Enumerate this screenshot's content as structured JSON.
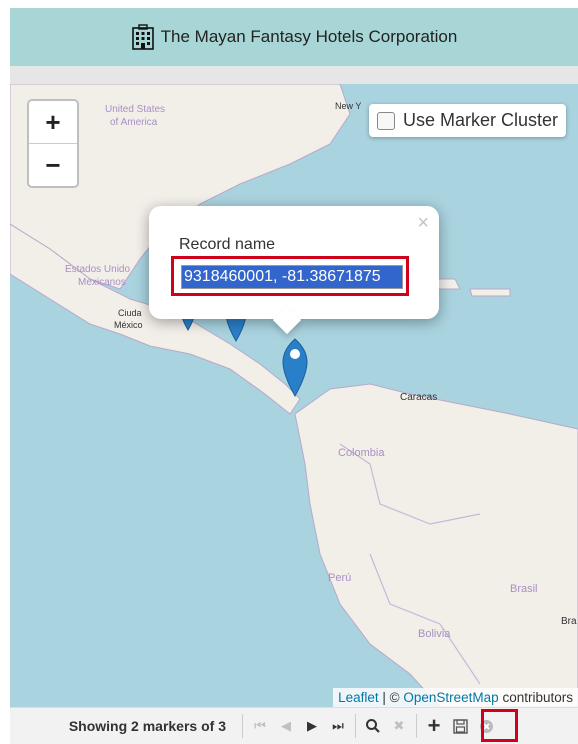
{
  "header": {
    "title": "The Mayan Fantasy Hotels Corporation",
    "icon": "hotel-building-icon"
  },
  "map": {
    "zoom_in_label": "+",
    "zoom_out_label": "−",
    "cluster_label": "Use Marker Cluster",
    "cluster_checked": false,
    "place_labels": {
      "usa": "United States of America",
      "new_york": "New Y",
      "mexico": "Estados Unidos Mexicanos",
      "mexico_city": "Ciudad de México",
      "caracas": "Caracas",
      "colombia": "Colombia",
      "peru": "Perú",
      "brasil": "Brasil",
      "bolivia": "Bolivia",
      "bra_edge": "Bra"
    },
    "popup": {
      "label": "Record name",
      "value": "9318460001, -81.38671875",
      "close": "×"
    },
    "attribution": {
      "leaflet": "Leaflet",
      "sep": " | © ",
      "osm": "OpenStreetMap",
      "contributors": " contributors"
    }
  },
  "toolbar": {
    "status": "Showing 2 markers of 3",
    "buttons": [
      {
        "name": "first-page-icon",
        "glyph": "⏮",
        "enabled": false
      },
      {
        "name": "prev-icon",
        "glyph": "◀",
        "enabled": false
      },
      {
        "name": "next-icon",
        "glyph": "▶",
        "enabled": true
      },
      {
        "name": "last-page-icon",
        "glyph": "⏭",
        "enabled": true
      },
      {
        "name": "search-icon",
        "glyph": "🔍",
        "enabled": true
      },
      {
        "name": "clear-icon",
        "glyph": "✖",
        "enabled": false
      },
      {
        "name": "add-icon",
        "glyph": "+",
        "enabled": true
      },
      {
        "name": "save-icon",
        "glyph": "💾",
        "enabled": true
      },
      {
        "name": "cancel-icon",
        "glyph": "⊗",
        "enabled": false
      }
    ]
  }
}
